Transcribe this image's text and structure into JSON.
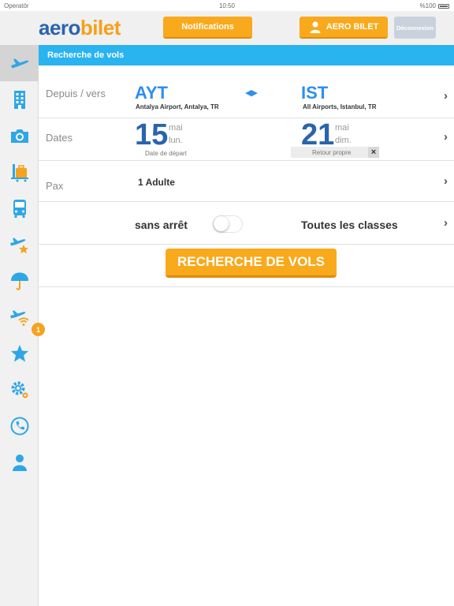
{
  "status_bar": {
    "carrier": "Operatör",
    "time": "10:50",
    "battery": "%100"
  },
  "header": {
    "logo_part1": "aero",
    "logo_part2": "bilet",
    "notifications_label": "Notifications",
    "user_label": "AERO BILET",
    "logout_label": "Déconnexion"
  },
  "sidebar": {
    "items": [
      {
        "icon": "plane-icon",
        "active": true
      },
      {
        "icon": "hotel-icon"
      },
      {
        "icon": "camera-icon"
      },
      {
        "icon": "luggage-icon"
      },
      {
        "icon": "bus-icon"
      },
      {
        "icon": "plane-star-icon"
      },
      {
        "icon": "umbrella-icon"
      },
      {
        "icon": "plane-wifi-icon"
      },
      {
        "icon": "star-icon"
      },
      {
        "icon": "settings-gear-icon"
      },
      {
        "icon": "phone-icon"
      },
      {
        "icon": "user-icon"
      }
    ],
    "favorites_badge": "1"
  },
  "search": {
    "section_title": "Recherche de vols",
    "route": {
      "label": "Depuis / vers",
      "from_code": "AYT",
      "from_airport": "Antalya Airport, Antalya, TR",
      "to_code": "IST",
      "to_airport": "All Airports, Istanbul, TR"
    },
    "dates": {
      "label": "Dates",
      "depart_day": "15",
      "depart_month": "mai",
      "depart_weekday": "lun.",
      "depart_caption": "Date de départ",
      "return_day": "21",
      "return_month": "mai",
      "return_weekday": "dim.",
      "return_caption": "Retour propre",
      "clear_return": "×"
    },
    "pax": {
      "label": "Pax",
      "value": "1 Adulte"
    },
    "options": {
      "nonstop_label": "sans arrêt",
      "nonstop_on": false,
      "class_label": "Toutes les classes"
    },
    "submit_label": "RECHERCHE DE VOLS"
  },
  "colors": {
    "accent_orange": "#f9a91c",
    "accent_blue": "#29b3ef",
    "brand_blue": "#2a64ad"
  }
}
